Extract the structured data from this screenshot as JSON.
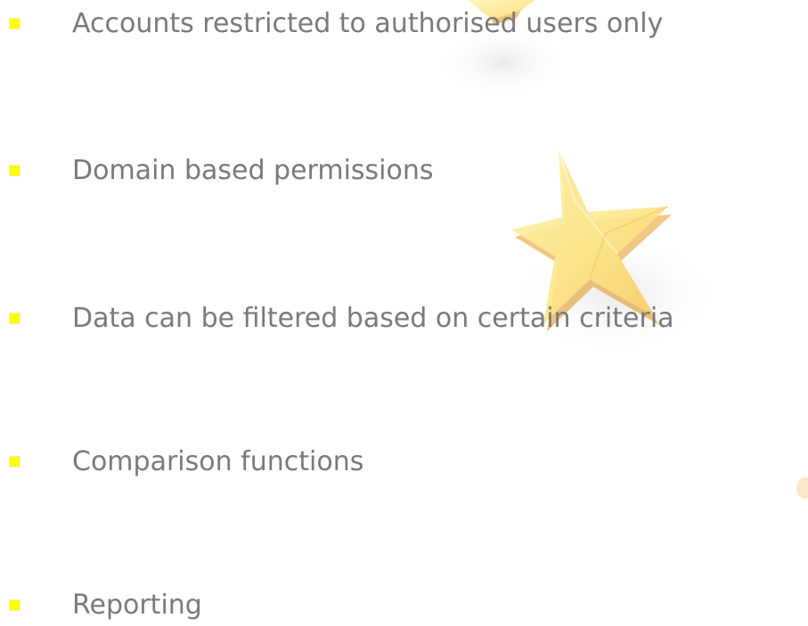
{
  "colors": {
    "background": "#ffffff",
    "bullet_marker": "#ffff00",
    "text": "#7a7a7a",
    "star_fill": "#fde98a",
    "star_edge": "#e8a43a"
  },
  "decorations": [
    "star-icon",
    "star-icon",
    "star-icon"
  ],
  "bullets": [
    {
      "text": "Accounts restricted to authorised users only"
    },
    {
      "text": "Domain based permissions"
    },
    {
      "text": "Data can be filtered based on certain criteria"
    },
    {
      "text": "Comparison functions"
    },
    {
      "text": "Reporting"
    }
  ]
}
